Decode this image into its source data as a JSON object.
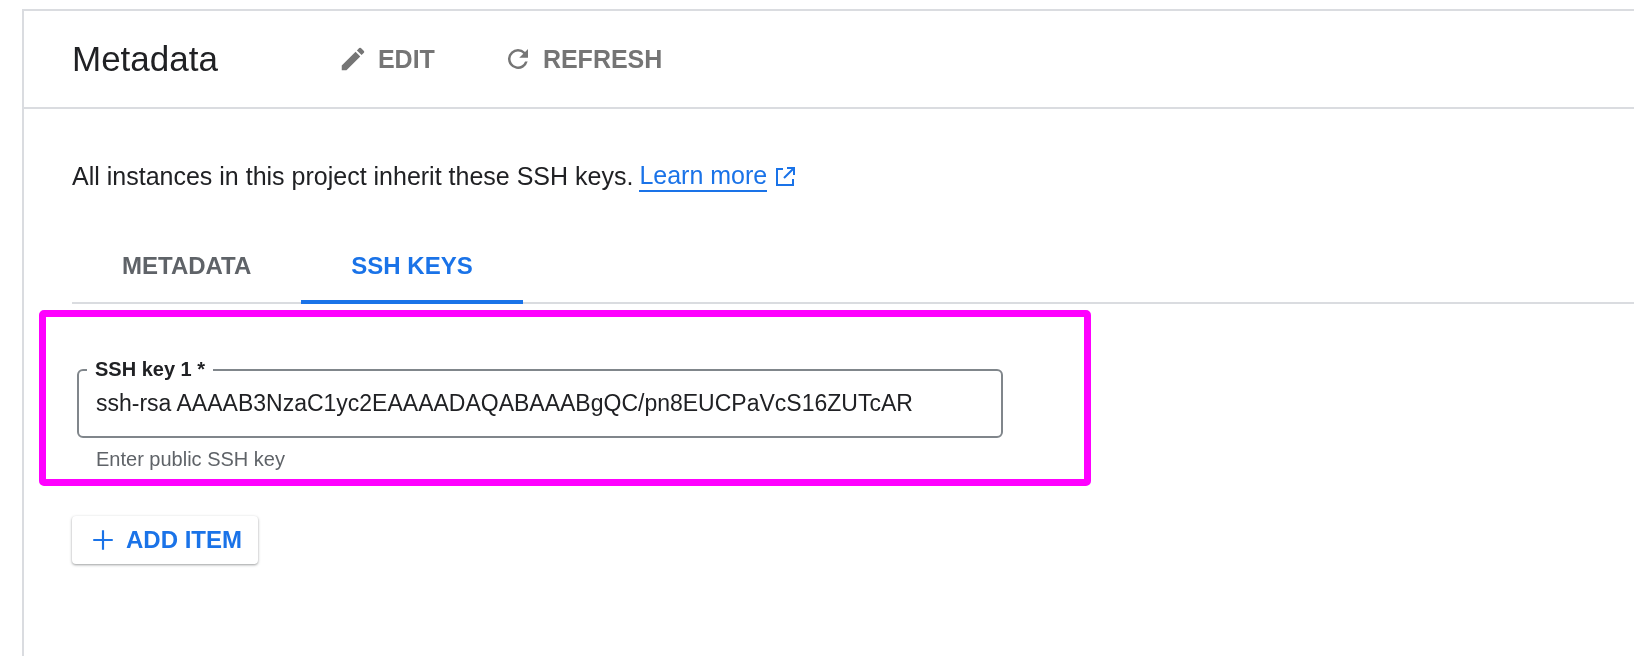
{
  "header": {
    "title": "Metadata",
    "actions": [
      {
        "label": "EDIT",
        "kind": "edit"
      },
      {
        "label": "REFRESH",
        "kind": "refresh"
      }
    ]
  },
  "description": {
    "text": "All instances in this project inherit these SSH keys.",
    "link": "Learn more"
  },
  "tabs": [
    {
      "label": "METADATA",
      "selected": false
    },
    {
      "label": "SSH KEYS",
      "selected": true
    }
  ],
  "ssh_keys": [
    {
      "label": "SSH key 1 *",
      "value": "ssh-rsa AAAAB3NzaC1yc2EAAAADAQABAAABgQC/pn8EUCPaVcS16ZUTcAR",
      "helper": "Enter public SSH key",
      "highlighted": true
    }
  ],
  "add_button": {
    "label": "ADD ITEM"
  }
}
